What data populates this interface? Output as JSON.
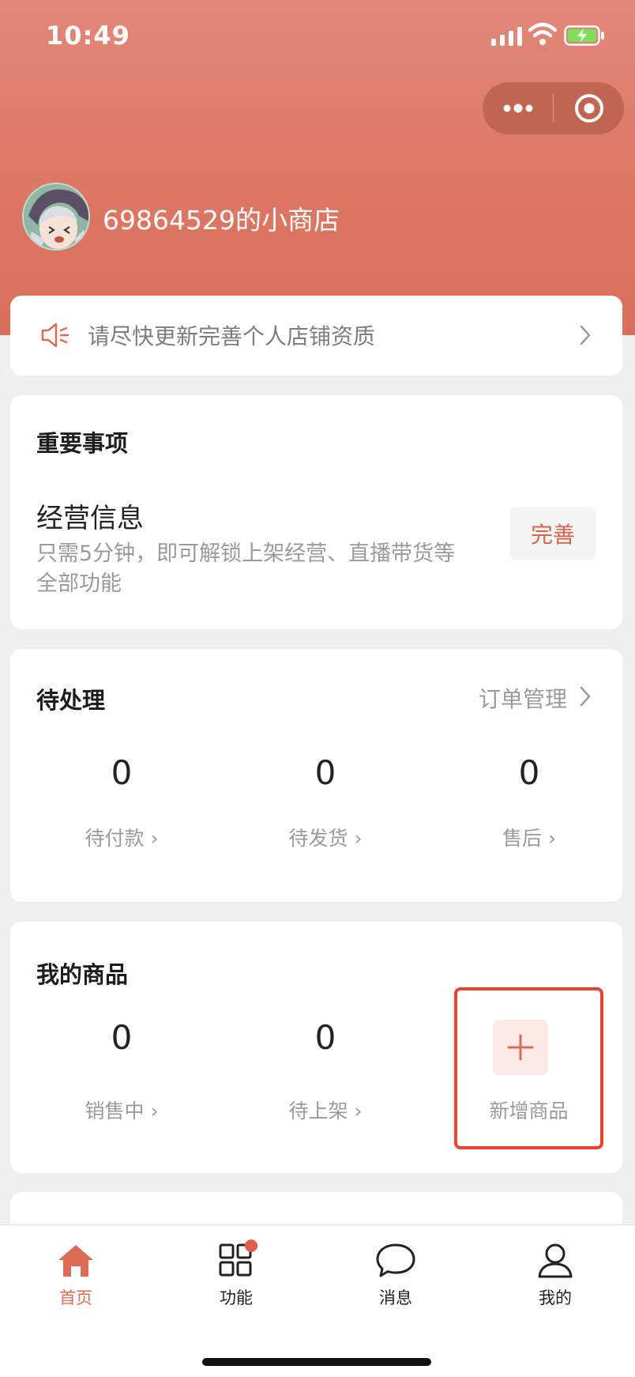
{
  "status_bar": {
    "time": "10:49"
  },
  "header": {
    "shop_name": "69864529的小商店",
    "capsule": {
      "more_icon": "more-dots-icon",
      "close_icon": "target-circle-icon"
    }
  },
  "notice": {
    "text": "请尽快更新完善个人店铺资质",
    "icon": "speaker-icon"
  },
  "important": {
    "title": "重要事项",
    "item_title": "经营信息",
    "item_desc": "只需5分钟，即可解锁上架经营、直播带货等全部功能",
    "action_label": "完善"
  },
  "pending": {
    "title": "待处理",
    "link_label": "订单管理",
    "stats": [
      {
        "value": "0",
        "label": "待付款"
      },
      {
        "value": "0",
        "label": "待发货"
      },
      {
        "value": "0",
        "label": "售后"
      }
    ]
  },
  "goods": {
    "title": "我的商品",
    "stats": [
      {
        "value": "0",
        "label": "销售中"
      },
      {
        "value": "0",
        "label": "待上架"
      }
    ],
    "add_label": "新增商品"
  },
  "tabbar": {
    "items": [
      {
        "label": "首页",
        "icon": "home-icon",
        "active": true
      },
      {
        "label": "功能",
        "icon": "grid-icon",
        "badge": true
      },
      {
        "label": "消息",
        "icon": "chat-bubble-icon"
      },
      {
        "label": "我的",
        "icon": "person-icon"
      }
    ]
  },
  "colors": {
    "accent": "#dc6c57",
    "highlight_border": "#e8432f",
    "header": "#dc7764"
  }
}
